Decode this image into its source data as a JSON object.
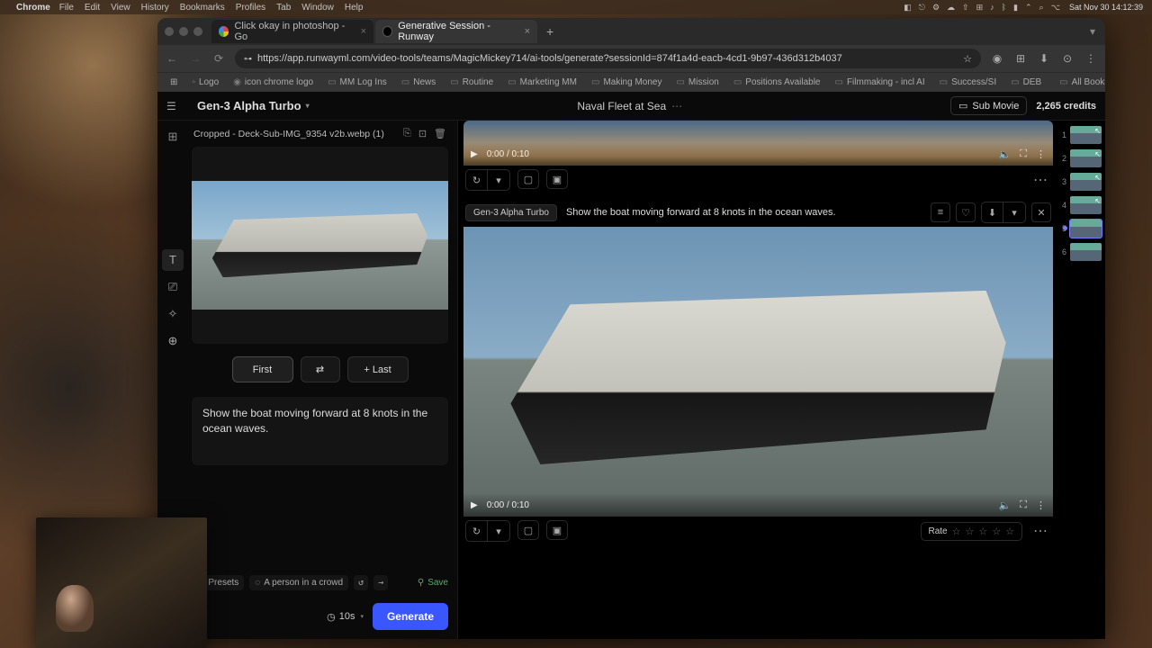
{
  "menubar": {
    "app": "Chrome",
    "items": [
      "File",
      "Edit",
      "View",
      "History",
      "Bookmarks",
      "Profiles",
      "Tab",
      "Window",
      "Help"
    ],
    "clock": "Sat Nov 30  14:12:39"
  },
  "browser": {
    "tabs": [
      {
        "title": "Click okay in photoshop - Go",
        "active": false
      },
      {
        "title": "Generative Session - Runway",
        "active": true
      }
    ],
    "url": "https://app.runwayml.com/video-tools/teams/MagicMickey714/ai-tools/generate?sessionId=874f1a4d-eacb-4cd1-9b97-436d312b4037",
    "bookmarks": [
      "Logo",
      "icon chrome logo",
      "MM Log Ins",
      "News",
      "Routine",
      "Marketing MM",
      "Making Money",
      "Mission",
      "Positions Available",
      "Filmmaking - incl AI",
      "Success/SI",
      "DEB"
    ],
    "all_bookmarks": "All Bookmarks"
  },
  "app": {
    "model": "Gen-3 Alpha Turbo",
    "session_title": "Naval Fleet at Sea",
    "sub_movie": "Sub Movie",
    "credits": "2,265 credits"
  },
  "asset": {
    "name": "Cropped - Deck-Sub-IMG_9354 v2b.webp (1)"
  },
  "frames": {
    "first": "First",
    "last": "+ Last"
  },
  "prompt": {
    "text": "Show the boat moving forward at 8 knots in the ocean waves.",
    "presets": "Presets",
    "suggestion": "A person in a crowd",
    "save": "Save"
  },
  "generate": {
    "duration": "10s",
    "button": "Generate"
  },
  "result": {
    "model_pill": "Gen-3 Alpha Turbo",
    "prompt": "Show the boat moving forward at 8 knots in the ocean waves.",
    "time_current": "0:00",
    "time_total": "0:10",
    "rate_label": "Rate"
  },
  "result_top": {
    "time_current": "0:00",
    "time_total": "0:10"
  },
  "thumbs": [
    "1",
    "2",
    "3",
    "4",
    "5",
    "6"
  ]
}
